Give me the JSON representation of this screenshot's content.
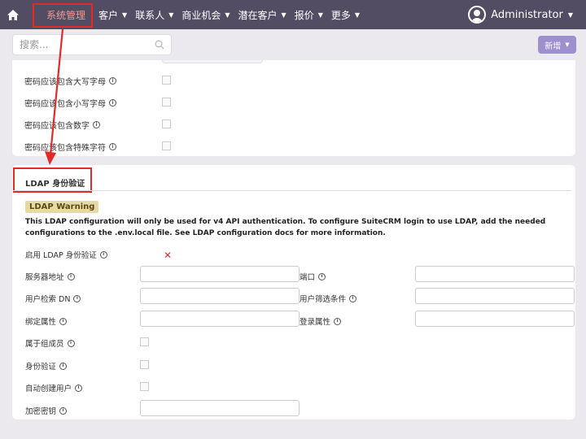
{
  "nav": {
    "items": [
      {
        "label": "系统管理",
        "caret": false,
        "active": true
      },
      {
        "label": "客户",
        "caret": true
      },
      {
        "label": "联系人",
        "caret": true
      },
      {
        "label": "商业机会",
        "caret": true
      },
      {
        "label": "潜在客户",
        "caret": true
      },
      {
        "label": "报价",
        "caret": true
      },
      {
        "label": "更多",
        "caret": true
      }
    ],
    "user": "Administrator"
  },
  "search": {
    "placeholder": "搜索..."
  },
  "new_button": {
    "label": "新增"
  },
  "password_rules": [
    {
      "label": "密码应该包含大写字母",
      "checked": false
    },
    {
      "label": "密码应该包含小写字母",
      "checked": false
    },
    {
      "label": "密码应该包含数字",
      "checked": false
    },
    {
      "label": "密码应该包含特殊字符",
      "checked": false
    }
  ],
  "ldap": {
    "title": "LDAP 身份验证",
    "warning_badge": "LDAP Warning",
    "description": "This LDAP configuration will only be used for v4 API authentication. To configure SuiteCRM login to use LDAP, add the needed configurations to the .env.local file. See LDAP configuration docs for more information.",
    "enable_label": "启用 LDAP 身份验证",
    "fields": {
      "server_address": "服务器地址",
      "port": "端口",
      "user_dn": "用户检索 DN",
      "user_filter": "用户筛选条件",
      "bind_attr": "绑定属性",
      "login_attr": "登录属性",
      "group_member": "属于组成员",
      "auth": "身份验证",
      "auto_create": "自动创建用户",
      "encrypt_key": "加密密钥"
    }
  },
  "colors": {
    "nav_bg": "#534d64",
    "accent": "#9e8fcf",
    "highlight": "#e12b2b",
    "active_nav": "#f59a8b"
  }
}
